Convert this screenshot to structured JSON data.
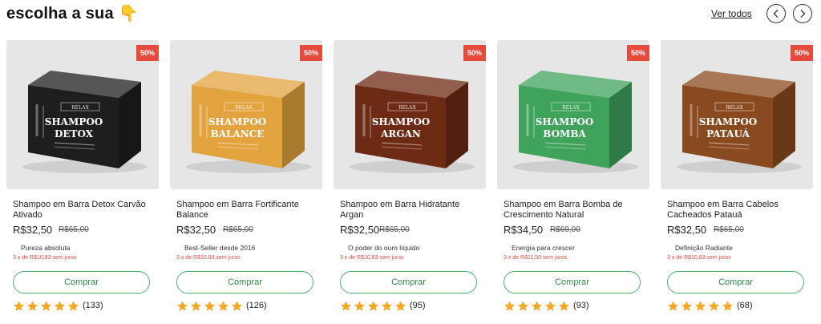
{
  "header": {
    "title": "escolha a sua",
    "title_emoji": "👇",
    "see_all": "Ver todos"
  },
  "products": [
    {
      "name": "Shampoo em Barra Detox Carvão Ativado",
      "price": "R$32,50",
      "old_price": "R$65,00",
      "discount": "50%",
      "tagline": "Pureza absoluta",
      "installments": "3 x de R$10,83 sem juros",
      "buy_label": "Comprar",
      "rating": 5,
      "reviews": "(133)",
      "box_label_1": "SHAMPOO",
      "box_label_2": "DETOX",
      "box_color": "#1e1e1e",
      "label_color": "#ffffff"
    },
    {
      "name": "Shampoo em Barra Fortificante Balance",
      "price": "R$32,50",
      "old_price": "R$65,00",
      "discount": "50%",
      "tagline": "Best-Seller desde 2016",
      "installments": "3 x de R$10,83 sem juros",
      "buy_label": "Comprar",
      "rating": 5,
      "reviews": "(126)",
      "box_label_1": "SHAMPOO",
      "box_label_2": "BALANCE",
      "box_color": "#e3a33f",
      "label_color": "#ffffff"
    },
    {
      "name": "Shampoo em Barra Hidratante Argan",
      "price": "R$32,50",
      "old_price": "R$65,00",
      "discount": "50%",
      "tagline": "O poder do ouro líquido",
      "installments": "3 x de R$10,83 sem juros",
      "buy_label": "Comprar",
      "rating": 5,
      "reviews": "(95)",
      "box_label_1": "SHAMPOO",
      "box_label_2": "ARGAN",
      "box_color": "#6d2a14",
      "label_color": "#ffffff"
    },
    {
      "name": "Shampoo em Barra Bomba de Crescimento Natural",
      "price": "R$34,50",
      "old_price": "R$69,00",
      "discount": "50%",
      "tagline": "Energia para crescer",
      "installments": "3 x de R$11,50 sem juros",
      "buy_label": "Comprar",
      "rating": 5,
      "reviews": "(93)",
      "box_label_1": "SHAMPOO",
      "box_label_2": "BOMBA",
      "box_color": "#3fa35c",
      "label_color": "#ffffff"
    },
    {
      "name": "Shampoo em Barra Cabelos Cacheados Patauá",
      "price": "R$32,50",
      "old_price": "R$65,00",
      "discount": "50%",
      "tagline": "Definição Radiante",
      "installments": "3 x de R$10,83 sem juros",
      "buy_label": "Comprar",
      "rating": 5,
      "reviews": "(68)",
      "box_label_1": "SHAMPOO",
      "box_label_2": "PATAUÁ",
      "box_color": "#8a4a1f",
      "label_color": "#ffffff"
    }
  ],
  "colors": {
    "badge": "#e64a3c",
    "buy_border": "#4aaf6a",
    "star": "#f5a623"
  }
}
